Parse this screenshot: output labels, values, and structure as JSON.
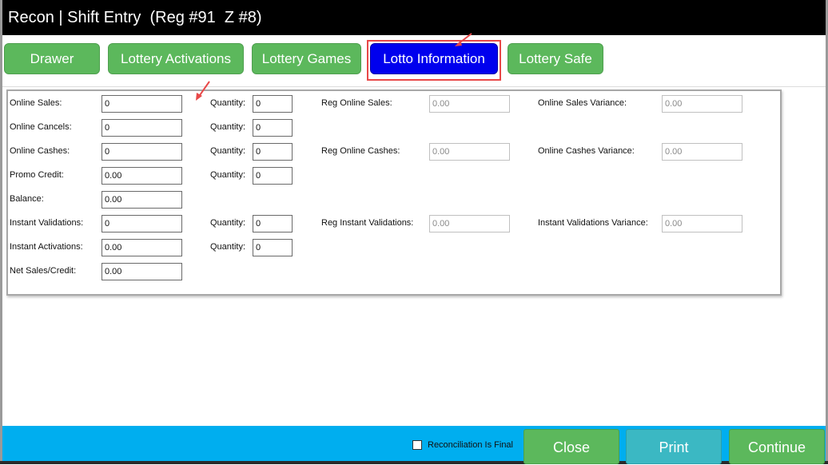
{
  "window": {
    "title": "Recon | Shift Entry  (Reg #91  Z #8)"
  },
  "tabs": [
    {
      "label": "Drawer"
    },
    {
      "label": "Lottery Activations"
    },
    {
      "label": "Lottery Games"
    },
    {
      "label": "Lotto Information",
      "active": true
    },
    {
      "label": "Lottery Safe"
    }
  ],
  "form": {
    "online_sales": {
      "label": "Online Sales:",
      "value": "0"
    },
    "online_cancels": {
      "label": "Online Cancels:",
      "value": "0"
    },
    "online_cashes": {
      "label": "Online Cashes:",
      "value": "0"
    },
    "promo_credit": {
      "label": "Promo Credit:",
      "value": "0.00"
    },
    "balance": {
      "label": "Balance:",
      "value": "0.00"
    },
    "instant_validations": {
      "label": "Instant Validations:",
      "value": "0"
    },
    "instant_activations": {
      "label": "Instant Activations:",
      "value": "0.00"
    },
    "net_sales_credit": {
      "label": "Net Sales/Credit:",
      "value": "0.00"
    },
    "quantity_label": "Quantity:",
    "quantities": [
      "0",
      "0",
      "0",
      "0",
      "0",
      "0"
    ],
    "reg_online_sales": {
      "label": "Reg Online Sales:",
      "value": "0.00"
    },
    "reg_online_cashes": {
      "label": "Reg Online Cashes:",
      "value": "0.00"
    },
    "reg_instant_validations": {
      "label": "Reg Instant Validations:",
      "value": "0.00"
    },
    "online_sales_variance": {
      "label": "Online Sales Variance:",
      "value": "0.00"
    },
    "online_cashes_variance": {
      "label": "Online Cashes Variance:",
      "value": "0.00"
    },
    "instant_validations_variance": {
      "label": "Instant Validations Variance:",
      "value": "0.00"
    }
  },
  "footer": {
    "reconciliation_final_label": "Reconciliation Is Final",
    "reconciliation_final_checked": false,
    "close_label": "Close",
    "print_label": "Print",
    "continue_label": "Continue"
  },
  "colors": {
    "tab_green": "#5cb85c",
    "tab_active": "#0000ee",
    "annotation_red": "#e84848",
    "footer_blue": "#00aeef"
  },
  "icons": [
    "annotation-arrow-icon",
    "annotation-arrow-icon"
  ]
}
